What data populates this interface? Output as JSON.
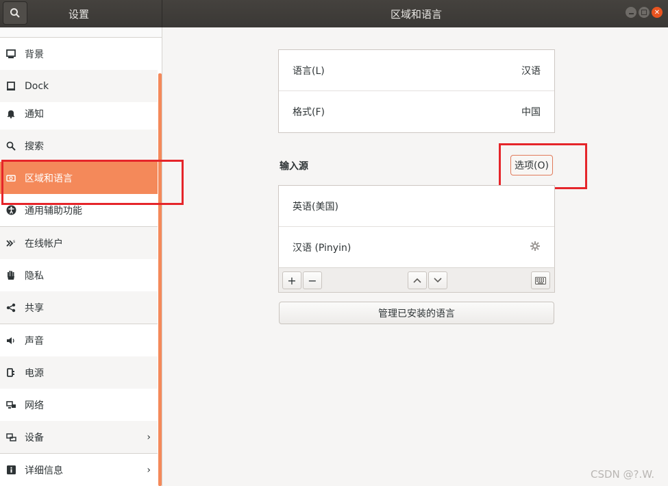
{
  "titlebar": {
    "sidebar_title": "设置",
    "main_title": "区域和语言"
  },
  "sidebar": {
    "items": [
      {
        "label": "背景",
        "icon": "background-icon"
      },
      {
        "label": "Dock",
        "icon": "dock-icon"
      },
      {
        "label": "通知",
        "icon": "bell-icon"
      },
      {
        "label": "搜索",
        "icon": "search-icon"
      },
      {
        "label": "区域和语言",
        "icon": "region-icon",
        "active": true
      },
      {
        "label": "通用辅助功能",
        "icon": "accessibility-icon"
      },
      {
        "label": "在线帐户",
        "icon": "online-accounts-icon"
      },
      {
        "label": "隐私",
        "icon": "hand-icon"
      },
      {
        "label": "共享",
        "icon": "share-icon"
      },
      {
        "label": "声音",
        "icon": "speaker-icon"
      },
      {
        "label": "电源",
        "icon": "power-icon"
      },
      {
        "label": "网络",
        "icon": "network-icon"
      },
      {
        "label": "设备",
        "icon": "devices-icon",
        "chevron": "›"
      },
      {
        "label": "详细信息",
        "icon": "info-icon",
        "chevron": "›"
      }
    ]
  },
  "main": {
    "language": {
      "label": "语言(L)",
      "value": "汉语"
    },
    "formats": {
      "label": "格式(F)",
      "value": "中国"
    },
    "input_sources": {
      "title": "输入源",
      "options_label": "选项(O)",
      "sources": [
        "英语(美国)",
        "汉语 (Pinyin)"
      ]
    },
    "toolbar": {
      "add": "+",
      "remove": "−",
      "up": "⌃",
      "down": "⌄"
    },
    "manage_label": "管理已安装的语言"
  },
  "watermark": "CSDN @?.W.",
  "colors": {
    "accent": "#f4895a",
    "highlight": "#e5252a",
    "titlebar": "#3d3b38"
  }
}
